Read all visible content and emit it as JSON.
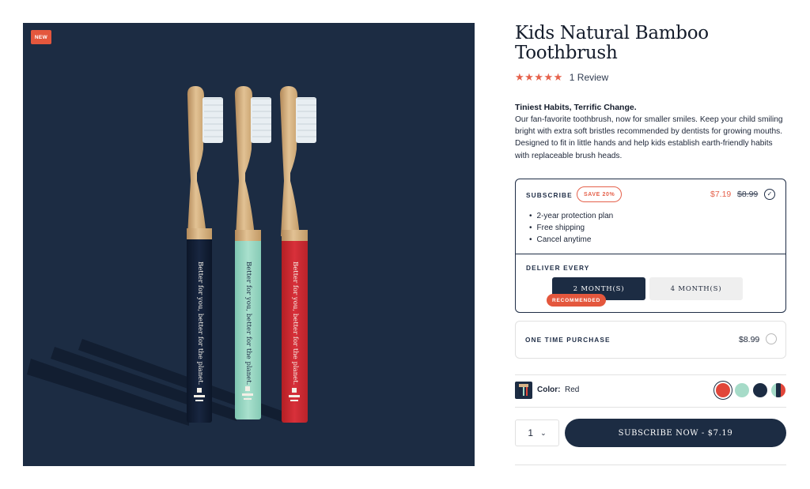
{
  "product": {
    "badge": "NEW",
    "title_line1": "Kids Natural Bamboo",
    "title_line2": "Toothbrush",
    "stars": "★★★★★",
    "rating": 5,
    "review_count": "1 Review",
    "tagline": "Tiniest Habits, Terrific Change.",
    "description": "Our fan-favorite toothbrush, now for smaller smiles. Keep your child smiling bright with extra soft bristles recommended by dentists for growing mouths. Designed to fit in little hands and help kids establish earth-friendly habits with replaceable brush heads.",
    "brush_slogan": "Better for you, better for the planet."
  },
  "subscribe": {
    "label": "SUBSCRIBE",
    "save_badge": "SAVE 20%",
    "price_sale": "$7.19",
    "price_original": "$8.99",
    "selected": true,
    "check": "✓",
    "benefits": [
      "2-year protection plan",
      "Free shipping",
      "Cancel anytime"
    ],
    "deliver_label": "DELIVER EVERY",
    "frequency_options": [
      "2 MONTH(S)",
      "4 MONTH(S)"
    ],
    "selected_frequency": "2 MONTH(S)",
    "recommended_badge": "RECOMMENDED"
  },
  "one_time": {
    "label": "ONE TIME PURCHASE",
    "price": "$8.99",
    "selected": false
  },
  "color": {
    "label": "Color:",
    "value": "Red",
    "swatches": [
      {
        "name": "red",
        "color": "#e1463a",
        "selected": true
      },
      {
        "name": "mint",
        "color": "#a6dbc8",
        "selected": false
      },
      {
        "name": "navy",
        "color": "#1c2c43",
        "selected": false
      },
      {
        "name": "multi",
        "color": "#a6dbc8/#1c2c43/#e1463a",
        "selected": false
      }
    ]
  },
  "purchase": {
    "quantity": "1",
    "chevron": "⌄",
    "cta_label": "SUBSCRIBE NOW - $7.19"
  },
  "colors": {
    "navy": "#1c2c43",
    "accent": "#e5614b",
    "mint": "#a6dbc8",
    "red": "#e1463a",
    "bamboo": "#d7b387"
  }
}
